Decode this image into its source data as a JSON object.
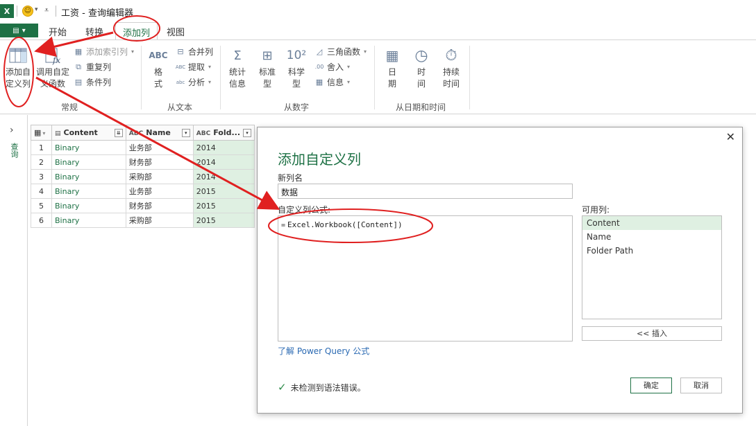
{
  "window": {
    "title": "工资 - 查询编辑器"
  },
  "quick_access": {
    "excel_logo": "X",
    "smiley_icon": "smiley-icon"
  },
  "tabs": {
    "file_label": "",
    "items": [
      {
        "label": "开始"
      },
      {
        "label": "转换"
      },
      {
        "label": "添加列",
        "active": true
      },
      {
        "label": "视图"
      }
    ]
  },
  "ribbon": {
    "general": {
      "label": "常规",
      "add_custom_column": "添加自\n定义列",
      "invoke_custom_function": "调用自定\n义函数",
      "add_index_column": "添加索引列",
      "duplicate_column": "重复列",
      "conditional_column": "条件列"
    },
    "from_text": {
      "label": "从文本",
      "format": "格\n式",
      "merge_columns": "合并列",
      "extract": "提取",
      "parse": "分析"
    },
    "from_number": {
      "label": "从数字",
      "statistics": "统计\n信息",
      "standard": "标准\n型",
      "scientific": "科学\n型",
      "trigonometry": "三角函数",
      "rounding": "舍入",
      "information": "信息"
    },
    "from_datetime": {
      "label": "从日期和时间",
      "date": "日\n期",
      "time": "时\n间",
      "duration": "持续\n时间"
    }
  },
  "left_nav": {
    "label": "查询"
  },
  "grid": {
    "headers": [
      "Content",
      "Name",
      "Fold..."
    ],
    "rows": [
      {
        "idx": "1",
        "content": "Binary",
        "name": "业务部",
        "folder": "2014"
      },
      {
        "idx": "2",
        "content": "Binary",
        "name": "财务部",
        "folder": "2014"
      },
      {
        "idx": "3",
        "content": "Binary",
        "name": "采购部",
        "folder": "2014"
      },
      {
        "idx": "4",
        "content": "Binary",
        "name": "业务部",
        "folder": "2015"
      },
      {
        "idx": "5",
        "content": "Binary",
        "name": "财务部",
        "folder": "2015"
      },
      {
        "idx": "6",
        "content": "Binary",
        "name": "采购部",
        "folder": "2015"
      }
    ]
  },
  "dialog": {
    "title": "添加自定义列",
    "new_column_label": "新列名",
    "new_column_value": "数据",
    "formula_label": "自定义列公式:",
    "formula_eq": "=",
    "formula_value": "Excel.Workbook([Content])",
    "available_label": "可用列:",
    "available_columns": [
      "Content",
      "Name",
      "Folder Path"
    ],
    "insert_button": "<< 插入",
    "learn_link": "了解 Power Query 公式",
    "status": "未检测到语法错误。",
    "ok_button": "确定",
    "cancel_button": "取消"
  },
  "colors": {
    "accent": "#1e7145",
    "annotation": "#e02020",
    "highlight": "#dff0e2"
  }
}
